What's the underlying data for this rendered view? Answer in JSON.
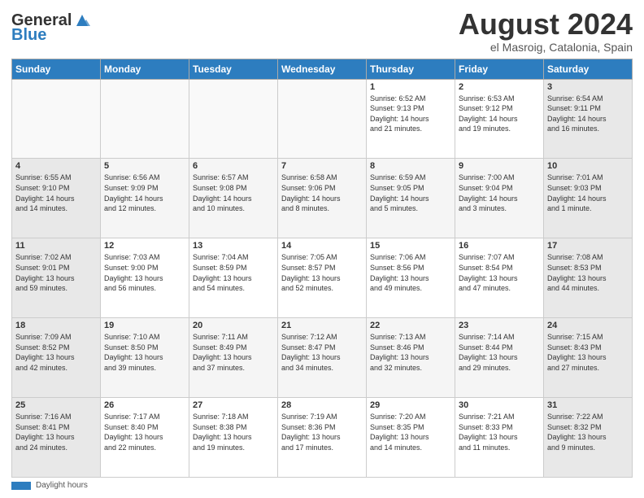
{
  "header": {
    "logo_general": "General",
    "logo_blue": "Blue",
    "month_title": "August 2024",
    "location": "el Masroig, Catalonia, Spain"
  },
  "footer": {
    "label": "Daylight hours"
  },
  "days_of_week": [
    "Sunday",
    "Monday",
    "Tuesday",
    "Wednesday",
    "Thursday",
    "Friday",
    "Saturday"
  ],
  "weeks": [
    [
      {
        "day": "",
        "info": ""
      },
      {
        "day": "",
        "info": ""
      },
      {
        "day": "",
        "info": ""
      },
      {
        "day": "",
        "info": ""
      },
      {
        "day": "1",
        "info": "Sunrise: 6:52 AM\nSunset: 9:13 PM\nDaylight: 14 hours\nand 21 minutes."
      },
      {
        "day": "2",
        "info": "Sunrise: 6:53 AM\nSunset: 9:12 PM\nDaylight: 14 hours\nand 19 minutes."
      },
      {
        "day": "3",
        "info": "Sunrise: 6:54 AM\nSunset: 9:11 PM\nDaylight: 14 hours\nand 16 minutes."
      }
    ],
    [
      {
        "day": "4",
        "info": "Sunrise: 6:55 AM\nSunset: 9:10 PM\nDaylight: 14 hours\nand 14 minutes."
      },
      {
        "day": "5",
        "info": "Sunrise: 6:56 AM\nSunset: 9:09 PM\nDaylight: 14 hours\nand 12 minutes."
      },
      {
        "day": "6",
        "info": "Sunrise: 6:57 AM\nSunset: 9:08 PM\nDaylight: 14 hours\nand 10 minutes."
      },
      {
        "day": "7",
        "info": "Sunrise: 6:58 AM\nSunset: 9:06 PM\nDaylight: 14 hours\nand 8 minutes."
      },
      {
        "day": "8",
        "info": "Sunrise: 6:59 AM\nSunset: 9:05 PM\nDaylight: 14 hours\nand 5 minutes."
      },
      {
        "day": "9",
        "info": "Sunrise: 7:00 AM\nSunset: 9:04 PM\nDaylight: 14 hours\nand 3 minutes."
      },
      {
        "day": "10",
        "info": "Sunrise: 7:01 AM\nSunset: 9:03 PM\nDaylight: 14 hours\nand 1 minute."
      }
    ],
    [
      {
        "day": "11",
        "info": "Sunrise: 7:02 AM\nSunset: 9:01 PM\nDaylight: 13 hours\nand 59 minutes."
      },
      {
        "day": "12",
        "info": "Sunrise: 7:03 AM\nSunset: 9:00 PM\nDaylight: 13 hours\nand 56 minutes."
      },
      {
        "day": "13",
        "info": "Sunrise: 7:04 AM\nSunset: 8:59 PM\nDaylight: 13 hours\nand 54 minutes."
      },
      {
        "day": "14",
        "info": "Sunrise: 7:05 AM\nSunset: 8:57 PM\nDaylight: 13 hours\nand 52 minutes."
      },
      {
        "day": "15",
        "info": "Sunrise: 7:06 AM\nSunset: 8:56 PM\nDaylight: 13 hours\nand 49 minutes."
      },
      {
        "day": "16",
        "info": "Sunrise: 7:07 AM\nSunset: 8:54 PM\nDaylight: 13 hours\nand 47 minutes."
      },
      {
        "day": "17",
        "info": "Sunrise: 7:08 AM\nSunset: 8:53 PM\nDaylight: 13 hours\nand 44 minutes."
      }
    ],
    [
      {
        "day": "18",
        "info": "Sunrise: 7:09 AM\nSunset: 8:52 PM\nDaylight: 13 hours\nand 42 minutes."
      },
      {
        "day": "19",
        "info": "Sunrise: 7:10 AM\nSunset: 8:50 PM\nDaylight: 13 hours\nand 39 minutes."
      },
      {
        "day": "20",
        "info": "Sunrise: 7:11 AM\nSunset: 8:49 PM\nDaylight: 13 hours\nand 37 minutes."
      },
      {
        "day": "21",
        "info": "Sunrise: 7:12 AM\nSunset: 8:47 PM\nDaylight: 13 hours\nand 34 minutes."
      },
      {
        "day": "22",
        "info": "Sunrise: 7:13 AM\nSunset: 8:46 PM\nDaylight: 13 hours\nand 32 minutes."
      },
      {
        "day": "23",
        "info": "Sunrise: 7:14 AM\nSunset: 8:44 PM\nDaylight: 13 hours\nand 29 minutes."
      },
      {
        "day": "24",
        "info": "Sunrise: 7:15 AM\nSunset: 8:43 PM\nDaylight: 13 hours\nand 27 minutes."
      }
    ],
    [
      {
        "day": "25",
        "info": "Sunrise: 7:16 AM\nSunset: 8:41 PM\nDaylight: 13 hours\nand 24 minutes."
      },
      {
        "day": "26",
        "info": "Sunrise: 7:17 AM\nSunset: 8:40 PM\nDaylight: 13 hours\nand 22 minutes."
      },
      {
        "day": "27",
        "info": "Sunrise: 7:18 AM\nSunset: 8:38 PM\nDaylight: 13 hours\nand 19 minutes."
      },
      {
        "day": "28",
        "info": "Sunrise: 7:19 AM\nSunset: 8:36 PM\nDaylight: 13 hours\nand 17 minutes."
      },
      {
        "day": "29",
        "info": "Sunrise: 7:20 AM\nSunset: 8:35 PM\nDaylight: 13 hours\nand 14 minutes."
      },
      {
        "day": "30",
        "info": "Sunrise: 7:21 AM\nSunset: 8:33 PM\nDaylight: 13 hours\nand 11 minutes."
      },
      {
        "day": "31",
        "info": "Sunrise: 7:22 AM\nSunset: 8:32 PM\nDaylight: 13 hours\nand 9 minutes."
      }
    ]
  ]
}
